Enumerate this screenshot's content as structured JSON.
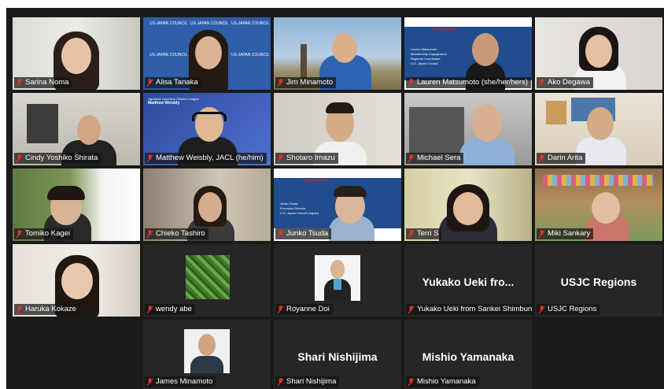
{
  "participants": [
    {
      "name": "Sarina Noma",
      "muted": true
    },
    {
      "name": "Alisa Tanaka",
      "muted": true
    },
    {
      "name": "Jim Minamoto",
      "muted": true
    },
    {
      "name": "Lauren Matsumoto (she/her/hers)",
      "muted": false,
      "active_speaker": true
    },
    {
      "name": "Ako Degawa",
      "muted": true
    },
    {
      "name": "Cindy Yoshiko Shirata",
      "muted": true
    },
    {
      "name": "Matthew Weisbly, JACL (he/him)",
      "muted": true
    },
    {
      "name": "Shotaro Imazu",
      "muted": true
    },
    {
      "name": "Michael Sera",
      "muted": true
    },
    {
      "name": "Darin Arita",
      "muted": true
    },
    {
      "name": "Tomiko Kagei",
      "muted": true
    },
    {
      "name": "Chieko Tashiro",
      "muted": true
    },
    {
      "name": "Junko Tsuda",
      "muted": true
    },
    {
      "name": "Terri S",
      "muted": true
    },
    {
      "name": "Miki Sankary",
      "muted": true
    },
    {
      "name": "Haruka Kokaze",
      "muted": true
    },
    {
      "name": "wendy abe",
      "muted": true
    },
    {
      "name": "Royanne Doi",
      "muted": true
    },
    {
      "name": "Yukako Ueki from Sankei Shimbun",
      "muted": true,
      "display_text": "Yukako Ueki fro..."
    },
    {
      "name": "USJC Regions",
      "muted": true,
      "display_text": "USJC Regions"
    },
    {
      "name": "James Minamoto",
      "muted": true
    },
    {
      "name": "Shari Nishijima",
      "muted": true,
      "display_text": "Shari Nishijima"
    },
    {
      "name": "Mishio Yamanaka",
      "muted": true,
      "display_text": "Mishio Yamanaka"
    }
  ],
  "banners": {
    "usjc": "US-JAPAN COUNCIL",
    "lauren_lines": [
      "Lauren Matsumoto",
      "Membership Engagement",
      "Regional Coordinator",
      "U.S.-Japan Council"
    ],
    "junko_lines": [
      "Junko Tsuda",
      "Executive Director",
      "U.S.-Japan Council (Japan)"
    ],
    "matthew_lines": [
      "Japanese American Citizens League",
      "Matthew Weisbly"
    ],
    "tomodachi": "ToMo DACHI"
  },
  "colors": {
    "active_border": "#d7e05a",
    "muted_icon": "#e0322c",
    "label_bg": "#141414"
  }
}
